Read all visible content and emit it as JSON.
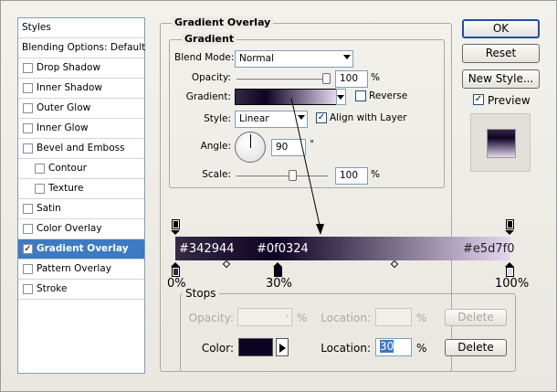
{
  "styles_list": {
    "header": "Styles",
    "blending": "Blending Options: Default",
    "items": [
      {
        "label": "Drop Shadow",
        "checked": false,
        "level": 1
      },
      {
        "label": "Inner Shadow",
        "checked": false,
        "level": 1
      },
      {
        "label": "Outer Glow",
        "checked": false,
        "level": 1
      },
      {
        "label": "Inner Glow",
        "checked": false,
        "level": 1
      },
      {
        "label": "Bevel and Emboss",
        "checked": false,
        "level": 1
      },
      {
        "label": "Contour",
        "checked": false,
        "level": 2
      },
      {
        "label": "Texture",
        "checked": false,
        "level": 2
      },
      {
        "label": "Satin",
        "checked": false,
        "level": 1
      },
      {
        "label": "Color Overlay",
        "checked": false,
        "level": 1
      },
      {
        "label": "Gradient Overlay",
        "checked": true,
        "level": 1,
        "selected": true
      },
      {
        "label": "Pattern Overlay",
        "checked": false,
        "level": 1
      },
      {
        "label": "Stroke",
        "checked": false,
        "level": 1
      }
    ]
  },
  "panel": {
    "title": "Gradient Overlay",
    "subtitle": "Gradient",
    "blend_mode_label": "Blend Mode:",
    "blend_mode_value": "Normal",
    "opacity_label": "Opacity:",
    "opacity_value": "100",
    "opacity_unit": "%",
    "gradient_label": "Gradient:",
    "reverse_label": "Reverse",
    "reverse_checked": false,
    "style_label": "Style:",
    "style_value": "Linear",
    "align_label": "Align with Layer",
    "align_checked": true,
    "angle_label": "Angle:",
    "angle_value": "90",
    "angle_unit": "°",
    "scale_label": "Scale:",
    "scale_value": "100",
    "scale_unit": "%"
  },
  "buttons": {
    "ok": "OK",
    "reset": "Reset",
    "new_style": "New Style...",
    "preview_label": "Preview",
    "preview_checked": true
  },
  "gradient_editor": {
    "stop_colors": [
      "#342944",
      "#0f0324",
      "#e5d7f0"
    ],
    "stop_labels": [
      "#342944",
      "#0f0324",
      "#e5d7f0"
    ],
    "percent_labels": [
      "0%",
      "30%",
      "100%"
    ]
  },
  "stops_panel": {
    "title": "Stops",
    "opacity_label": "Opacity:",
    "opacity_unit": "%",
    "location_label": "Location:",
    "location_unit": "%",
    "delete_label": "Delete",
    "color_label": "Color:",
    "color_swatch": "#0f0324",
    "location2_label": "Location:",
    "location2_value": "30",
    "location2_unit": "%",
    "delete2_label": "Delete"
  }
}
